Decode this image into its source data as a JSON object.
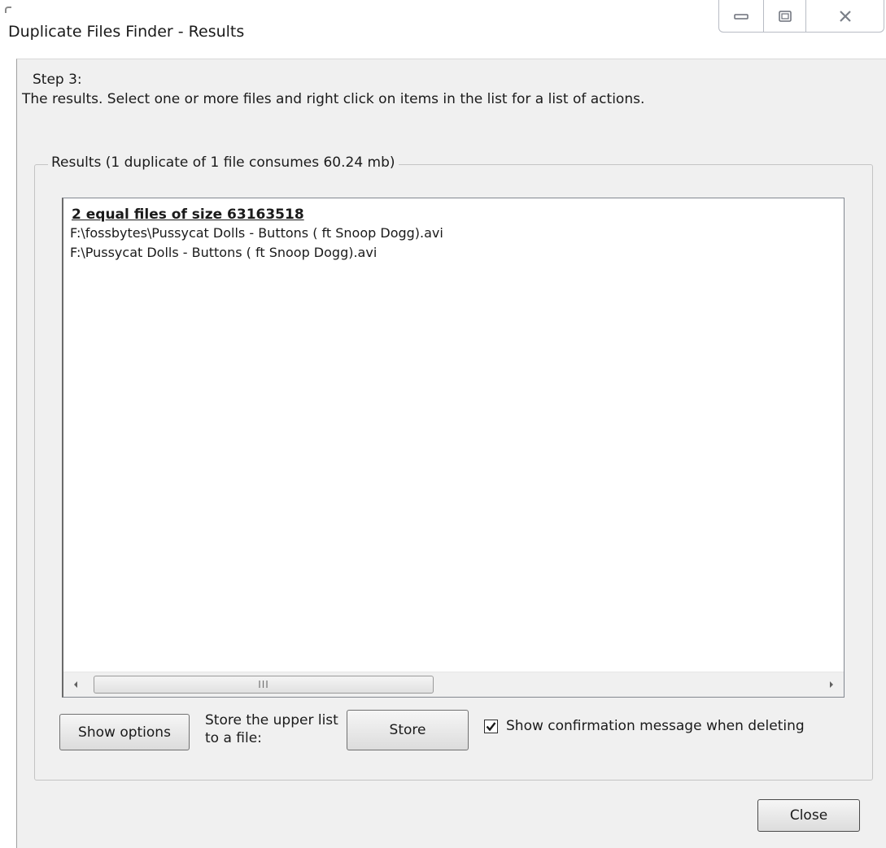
{
  "window": {
    "title": "Duplicate Files Finder - Results",
    "controls": {
      "minimize_icon": "minimize-icon",
      "maximize_icon": "maximize-icon",
      "close_icon": "close-icon"
    }
  },
  "instructions": {
    "step": "Step 3:",
    "description": "The results. Select one or more files and right click on items in the list for a list of actions."
  },
  "results": {
    "group_title": "Results (1 duplicate of 1 file consumes 60.24 mb)",
    "groups": [
      {
        "header": "2 equal files of size 63163518",
        "files": [
          "F:\\fossbytes\\Pussycat Dolls - Buttons ( ft Snoop Dogg).avi",
          "F:\\Pussycat Dolls - Buttons ( ft Snoop Dogg).avi"
        ]
      }
    ],
    "scrollbar": {
      "thumb_grip": "III",
      "left_arrow_icon": "left-arrow-icon",
      "right_arrow_icon": "right-arrow-icon"
    }
  },
  "footer": {
    "show_options_label": "Show options",
    "store_label": "Store the upper list to a file:",
    "store_button_label": "Store",
    "confirm_checkbox_label": "Show confirmation message when deleting",
    "confirm_checked": true,
    "close_button_label": "Close"
  },
  "colors": {
    "client_bg": "#f0f0f0",
    "list_bg": "#ffffff",
    "text": "#1a1a1a"
  }
}
